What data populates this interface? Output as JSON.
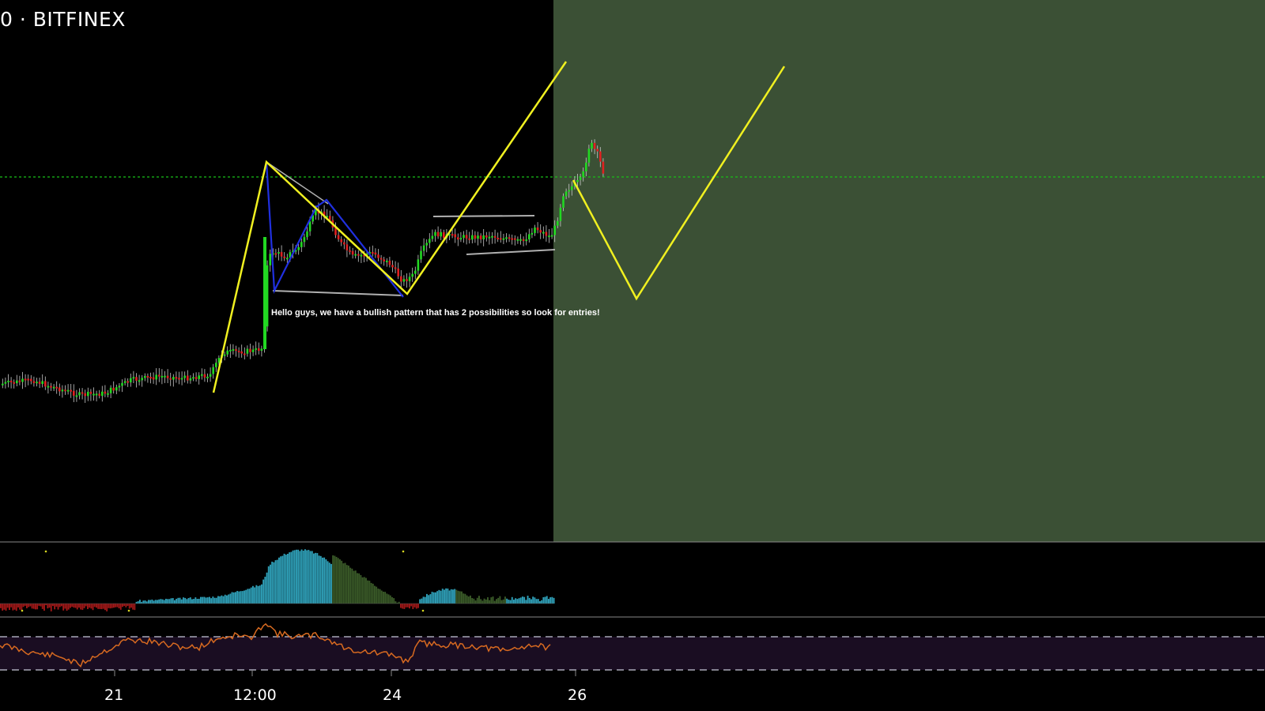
{
  "header": {
    "symbol_text": "0 · BITFINEX"
  },
  "annotation": "Hello guys, we have a bullish pattern that has 2 possibilities so look for entries!",
  "colors": {
    "background": "#000000",
    "forecast_zone": "#3b5035",
    "bull_candle": "#22d822",
    "bear_candle": "#e02020",
    "pattern_line": "#f0f020",
    "wedge_line": "#2030e0",
    "channel_line": "#b0b0b0",
    "level_line": "#18c018",
    "rsi_line": "#d86a20",
    "rsi_band": "#1a0d22",
    "hist_teal": "#2fa0b8",
    "hist_olive": "#3a5a28",
    "hist_red": "#a01818"
  },
  "chart_data": {
    "type": "candlestick",
    "x_axis": {
      "ticks": [
        "21",
        "12:00",
        "24",
        "26"
      ]
    },
    "price_level_line": {
      "style": "dashed"
    },
    "drawings": {
      "pattern_zigzag": "yellow",
      "wedge": "blue",
      "channel": "grey",
      "forecast_path": "yellow",
      "forecast_zone": "shaded green"
    },
    "indicators": [
      "histogram oscillator",
      "RSI with bands"
    ]
  }
}
